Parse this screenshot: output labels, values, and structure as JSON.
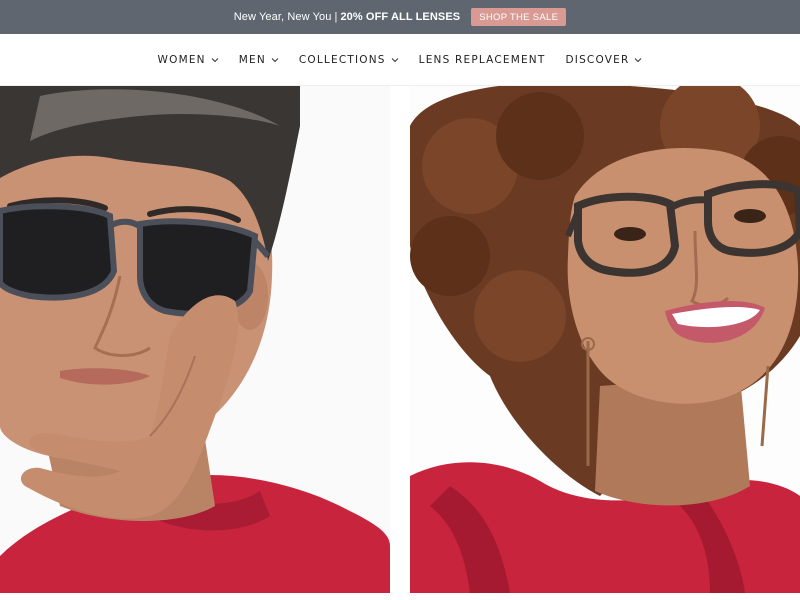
{
  "promo": {
    "text_regular": "New Year, New You",
    "separator": "|",
    "text_bold": "20% OFF ALL LENSES",
    "cta_label": "SHOP THE SALE",
    "bar_color": "#5f6670",
    "cta_color": "#d99a93"
  },
  "nav": {
    "items": [
      {
        "label": "WOMEN",
        "has_dropdown": true
      },
      {
        "label": "MEN",
        "has_dropdown": true
      },
      {
        "label": "COLLECTIONS",
        "has_dropdown": true
      },
      {
        "label": "LENS REPLACEMENT",
        "has_dropdown": false
      },
      {
        "label": "DISCOVER",
        "has_dropdown": true
      }
    ],
    "chevron_icon": "chevron-down-icon"
  },
  "hero": {
    "panels": [
      {
        "subject": "man-in-tortoise-sunglasses",
        "accent": "#c8243d"
      },
      {
        "subject": "woman-in-tortoise-eyeglasses",
        "accent": "#c8243d"
      }
    ]
  }
}
